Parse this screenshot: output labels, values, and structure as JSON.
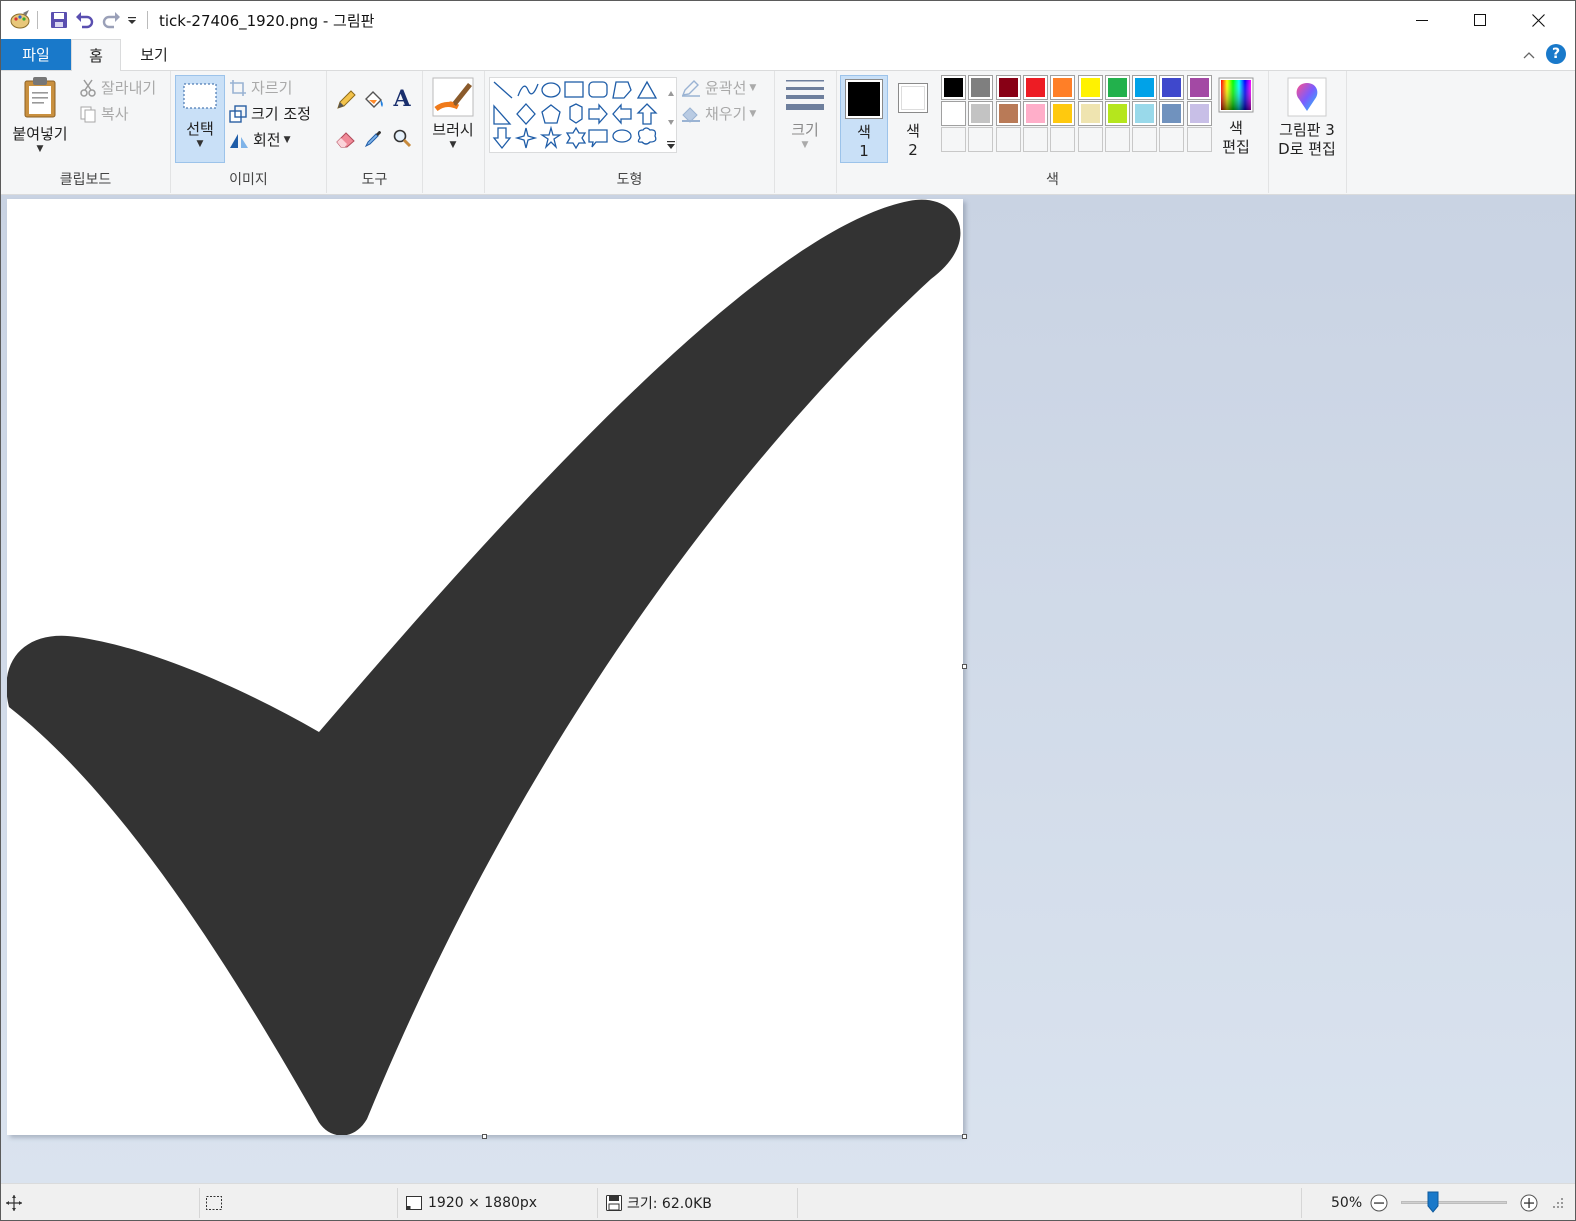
{
  "titlebar": {
    "title": "tick-27406_1920.png - 그림판",
    "minimize_icon": "minimize-icon",
    "maximize_icon": "maximize-icon",
    "close_icon": "close-icon"
  },
  "tabs": [
    {
      "label": "파일"
    },
    {
      "label": "홈"
    },
    {
      "label": "보기"
    }
  ],
  "ribbon": {
    "clipboard": {
      "label": "클립보드",
      "paste": "붙여넣기",
      "cut": "잘라내기",
      "copy": "복사"
    },
    "image": {
      "label": "이미지",
      "select": "선택",
      "crop": "자르기",
      "resize": "크기 조정",
      "rotate": "회전"
    },
    "tools": {
      "label": "도구"
    },
    "brushes": {
      "label": "브러시"
    },
    "shapes": {
      "label": "도형",
      "outline": "윤곽선",
      "fill": "채우기"
    },
    "size": {
      "label": "크기"
    },
    "colors": {
      "label": "색",
      "color1_line1": "색",
      "color1_line2": "1",
      "color2_line1": "색",
      "color2_line2": "2",
      "edit_line1": "색",
      "edit_line2": "편집",
      "color1": "#000000",
      "color2": "#ffffff",
      "palette_row1": [
        "#000000",
        "#7f7f7f",
        "#880015",
        "#ed1c24",
        "#ff7f27",
        "#fff200",
        "#22b14c",
        "#00a2e8",
        "#3f48cc",
        "#a349a4"
      ],
      "palette_row2": [
        "#ffffff",
        "#c3c3c3",
        "#b97a57",
        "#ffaec9",
        "#ffc90e",
        "#efe4b0",
        "#b5e61d",
        "#99d9ea",
        "#7092be",
        "#c8bfe7"
      ],
      "palette_row3": [
        "#ffffff",
        "#ffffff",
        "#ffffff",
        "#ffffff",
        "#ffffff",
        "#ffffff",
        "#ffffff",
        "#ffffff",
        "#ffffff",
        "#ffffff"
      ]
    },
    "paint3d": {
      "line1": "그림판 3",
      "line2": "D로 편집"
    }
  },
  "canvas": {
    "shape_color": "#333333"
  },
  "statusbar": {
    "dimensions": "1920 × 1880px",
    "filesize": "크기: 62.0KB",
    "zoom": "50%",
    "zoom_fraction": 0.28
  }
}
